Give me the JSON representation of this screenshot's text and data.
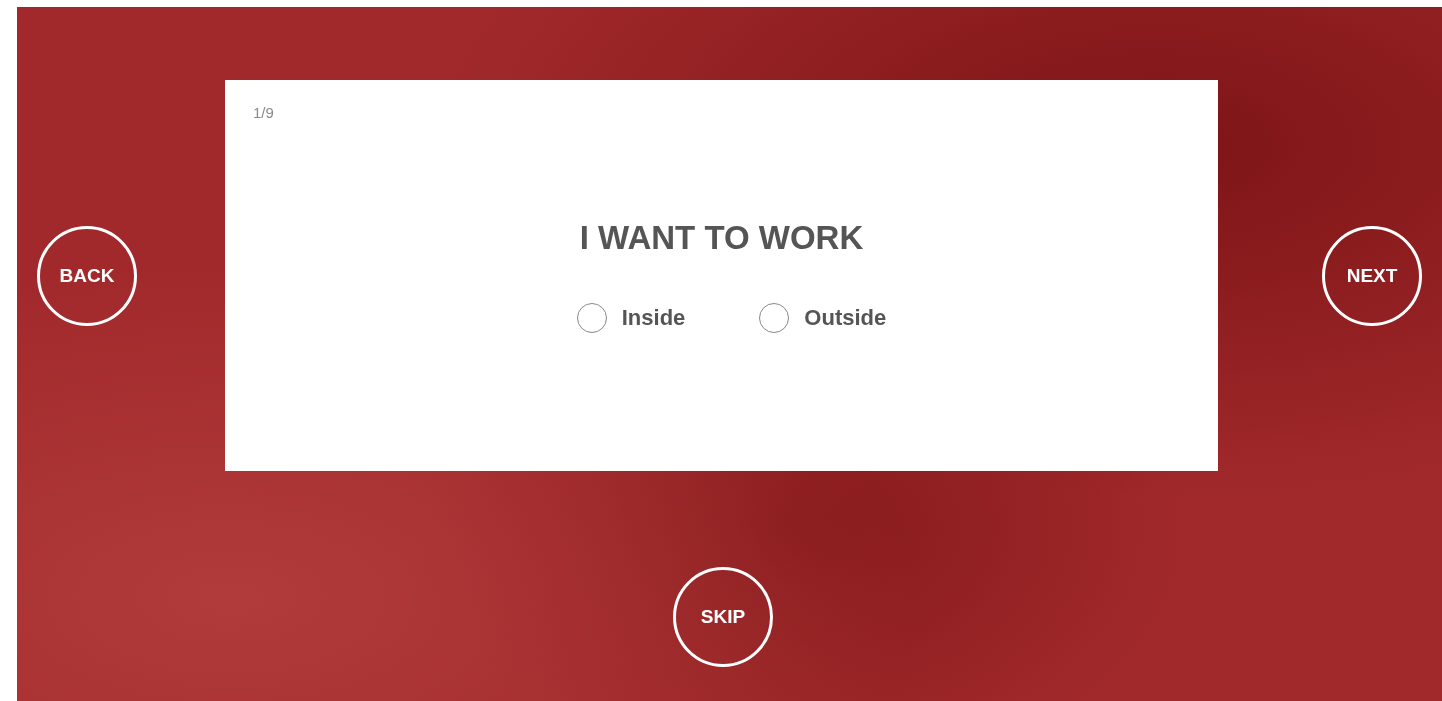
{
  "progress": "1/9",
  "question": "I WANT TO WORK",
  "options": [
    {
      "label": "Inside",
      "selected": false
    },
    {
      "label": "Outside",
      "selected": false
    }
  ],
  "buttons": {
    "back": "BACK",
    "next": "NEXT",
    "skip": "SKIP"
  }
}
